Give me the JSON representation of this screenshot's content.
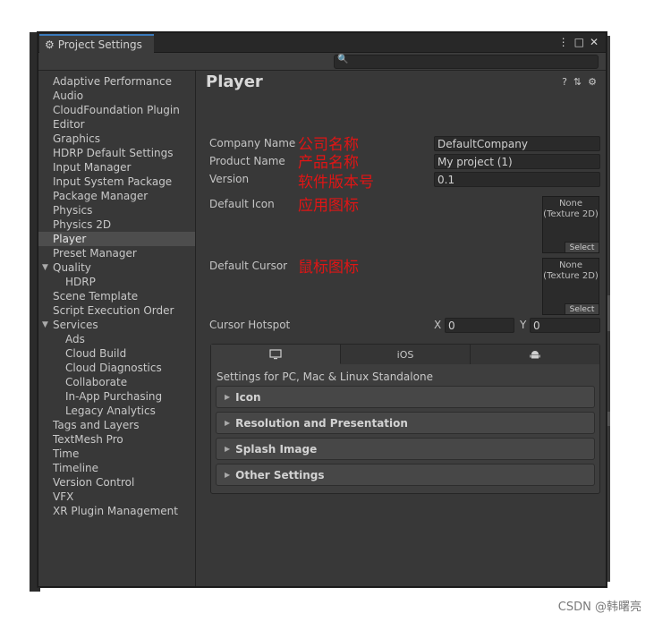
{
  "window": {
    "tab_title": "Project Settings",
    "controls": {
      "more": "⋮",
      "maximize": "□",
      "close": "✕"
    }
  },
  "search": {
    "placeholder": "",
    "value": ""
  },
  "sidebar": {
    "items": [
      {
        "label": "Adaptive Performance",
        "level": 0
      },
      {
        "label": "Audio",
        "level": 0
      },
      {
        "label": "CloudFoundation Plugin",
        "level": 0
      },
      {
        "label": "Editor",
        "level": 0
      },
      {
        "label": "Graphics",
        "level": 0
      },
      {
        "label": "HDRP Default Settings",
        "level": 0
      },
      {
        "label": "Input Manager",
        "level": 0
      },
      {
        "label": "Input System Package",
        "level": 0
      },
      {
        "label": "Package Manager",
        "level": 0
      },
      {
        "label": "Physics",
        "level": 0
      },
      {
        "label": "Physics 2D",
        "level": 0
      },
      {
        "label": "Player",
        "level": 0,
        "selected": true
      },
      {
        "label": "Preset Manager",
        "level": 0
      },
      {
        "label": "Quality",
        "level": 0,
        "expanded": true
      },
      {
        "label": "HDRP",
        "level": 1
      },
      {
        "label": "Scene Template",
        "level": 0
      },
      {
        "label": "Script Execution Order",
        "level": 0
      },
      {
        "label": "Services",
        "level": 0,
        "expanded": true
      },
      {
        "label": "Ads",
        "level": 1
      },
      {
        "label": "Cloud Build",
        "level": 1
      },
      {
        "label": "Cloud Diagnostics",
        "level": 1
      },
      {
        "label": "Collaborate",
        "level": 1
      },
      {
        "label": "In-App Purchasing",
        "level": 1
      },
      {
        "label": "Legacy Analytics",
        "level": 1
      },
      {
        "label": "Tags and Layers",
        "level": 0
      },
      {
        "label": "TextMesh Pro",
        "level": 0
      },
      {
        "label": "Time",
        "level": 0
      },
      {
        "label": "Timeline",
        "level": 0
      },
      {
        "label": "Version Control",
        "level": 0
      },
      {
        "label": "VFX",
        "level": 0
      },
      {
        "label": "XR Plugin Management",
        "level": 0
      }
    ]
  },
  "player": {
    "title": "Player",
    "company_name": {
      "label": "Company Name",
      "value": "DefaultCompany",
      "annotation": "公司名称"
    },
    "product_name": {
      "label": "Product Name",
      "value": "My project (1)",
      "annotation": "产品名称"
    },
    "version": {
      "label": "Version",
      "value": "0.1",
      "annotation": "软件版本号"
    },
    "default_icon": {
      "label": "Default Icon",
      "none_text": "None",
      "type_text": "(Texture 2D)",
      "select_label": "Select",
      "annotation": "应用图标"
    },
    "default_cursor": {
      "label": "Default Cursor",
      "none_text": "None",
      "type_text": "(Texture 2D)",
      "select_label": "Select",
      "annotation": "鼠标图标"
    },
    "cursor_hotspot": {
      "label": "Cursor Hotspot",
      "x_label": "X",
      "x_value": "0",
      "y_label": "Y",
      "y_value": "0"
    }
  },
  "platforms": {
    "tabs": [
      {
        "icon": "monitor-icon",
        "label": ""
      },
      {
        "icon": "",
        "label": "iOS"
      },
      {
        "icon": "android-icon",
        "label": ""
      }
    ],
    "caption": "Settings for PC, Mac & Linux Standalone",
    "sections": [
      "Icon",
      "Resolution and Presentation",
      "Splash Image",
      "Other Settings"
    ]
  },
  "watermark": "CSDN @韩曙亮",
  "colors": {
    "annotation": "#e01515",
    "selection": "#4d4d4d",
    "accent": "#3a79bb"
  }
}
